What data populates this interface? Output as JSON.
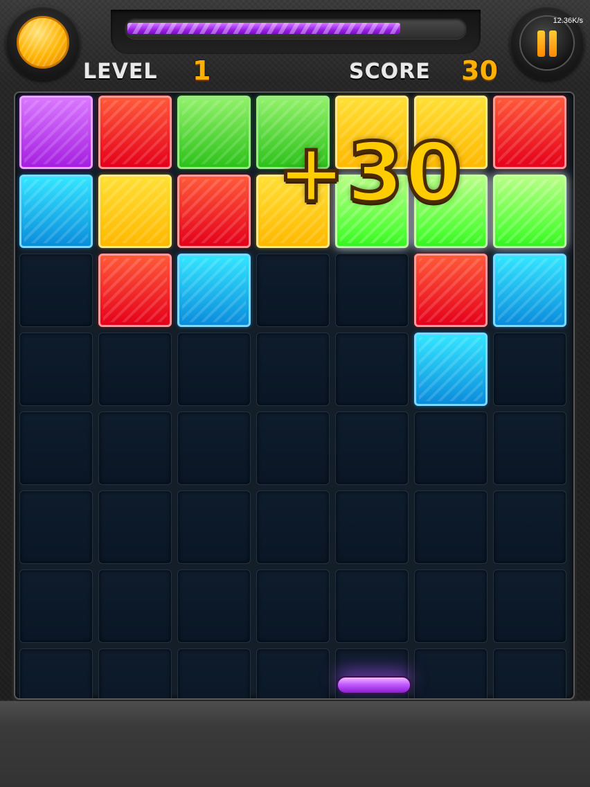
{
  "header": {
    "level_label": "LEVEL",
    "level_value": "1",
    "score_label": "SCORE",
    "score_value": "30",
    "progress_fraction": 0.81,
    "network_speed": "12.36K/s",
    "coin_icon": "gold-coin-icon",
    "pause_icon": "pause-icon"
  },
  "board": {
    "columns": 7,
    "rows": 8,
    "grid": [
      [
        "purple",
        "red",
        "green",
        "green",
        "yellow",
        "yellow",
        "red"
      ],
      [
        "blue",
        "yellow",
        "red",
        "yellow",
        "green-glow",
        "green-glow",
        "green-glow"
      ],
      [
        "empty",
        "red",
        "blue",
        "empty",
        "empty",
        "red",
        "blue"
      ],
      [
        "empty",
        "empty",
        "empty",
        "empty",
        "empty",
        "blue",
        "empty"
      ],
      [
        "empty",
        "empty",
        "empty",
        "empty",
        "empty",
        "empty",
        "empty"
      ],
      [
        "empty",
        "empty",
        "empty",
        "empty",
        "empty",
        "empty",
        "empty"
      ],
      [
        "empty",
        "empty",
        "empty",
        "empty",
        "empty",
        "empty",
        "empty"
      ],
      [
        "empty",
        "empty",
        "empty",
        "empty",
        "empty",
        "empty",
        "empty"
      ]
    ],
    "paddle_color": "purple",
    "paddle_column": 4
  },
  "popup": {
    "text": "+30"
  },
  "colors": {
    "accent": "#ffb000",
    "progress": "#9b22e6",
    "board_bg": "#141e28"
  }
}
